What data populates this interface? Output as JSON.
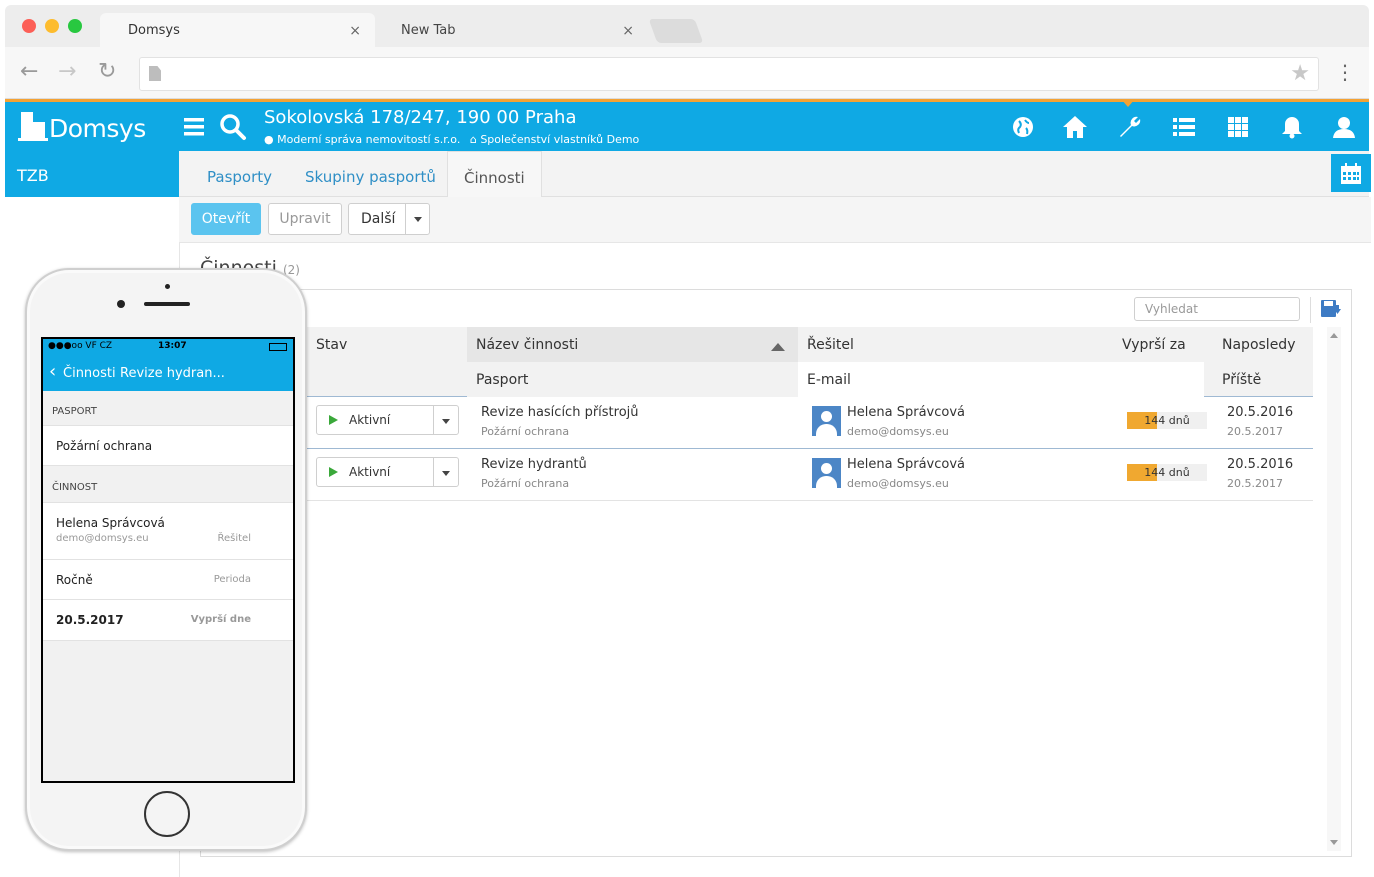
{
  "browser": {
    "tabs": [
      {
        "label": "Domsys",
        "close": "×"
      },
      {
        "label": "New Tab",
        "close": "×"
      }
    ],
    "nav": {
      "back": "←",
      "forward": "→",
      "reload": "↻",
      "star": "★",
      "menu": "⋮"
    }
  },
  "app": {
    "brand": "Domsys",
    "address": "Sokolovská 178/247, 190 00 Praha",
    "company": "Moderní správa nemovitostí s.r.o.",
    "association": "Společenství vlastníků Demo",
    "header_icons": [
      "menu-icon",
      "search-icon",
      "globe-icon",
      "home-icon",
      "wrench-icon",
      "list-icon",
      "grid-icon",
      "bell-icon",
      "user-icon"
    ],
    "accent": "#0fa9e4",
    "highlight": "#f4a234"
  },
  "sidebar": {
    "active_item": "TZB"
  },
  "tabs": [
    {
      "label": "Pasporty"
    },
    {
      "label": "Skupiny pasportů"
    },
    {
      "label": "Činnosti"
    }
  ],
  "actions": {
    "open": "Otevřít",
    "edit": "Upravit",
    "more": "Další"
  },
  "section": {
    "title": "Činnosti",
    "count": "(2)"
  },
  "search": {
    "placeholder": "Vyhledat"
  },
  "table": {
    "headers_row1": {
      "status": "Stav",
      "name": "Název činnosti",
      "solver": "Řešitel",
      "expires": "Vyprší za",
      "last": "Naposledy"
    },
    "headers_row2": {
      "passport": "Pasport",
      "email": "E-mail",
      "next": "Příště"
    },
    "rows": [
      {
        "status": "Aktivní",
        "name": "Revize hasících přístrojů",
        "passport": "Požární ochrana",
        "solver": "Helena Správcová",
        "email": "demo@domsys.eu",
        "expires": "144 dnů",
        "expires_fraction": 0.38,
        "last": "20.5.2016",
        "next": "20.5.2017"
      },
      {
        "status": "Aktivní",
        "name": "Revize hydrantů",
        "passport": "Požární ochrana",
        "solver": "Helena Správcová",
        "email": "demo@domsys.eu",
        "expires": "144 dnů",
        "expires_fraction": 0.38,
        "last": "20.5.2016",
        "next": "20.5.2017"
      }
    ]
  },
  "phone": {
    "status": {
      "carrier": "●●●oo VF CZ",
      "time": "13:07"
    },
    "nav": {
      "back": "Činnosti",
      "title": "Revize hydran..."
    },
    "section1": "PASPORT",
    "passport": "Požární ochrana",
    "section2": "ČINNOST",
    "solver_name": "Helena Správcová",
    "solver_email": "demo@domsys.eu",
    "solver_label": "Řešitel",
    "period_value": "Ročně",
    "period_label": "Perioda",
    "expiry_value": "20.5.2017",
    "expiry_label": "Vyprší dne"
  }
}
